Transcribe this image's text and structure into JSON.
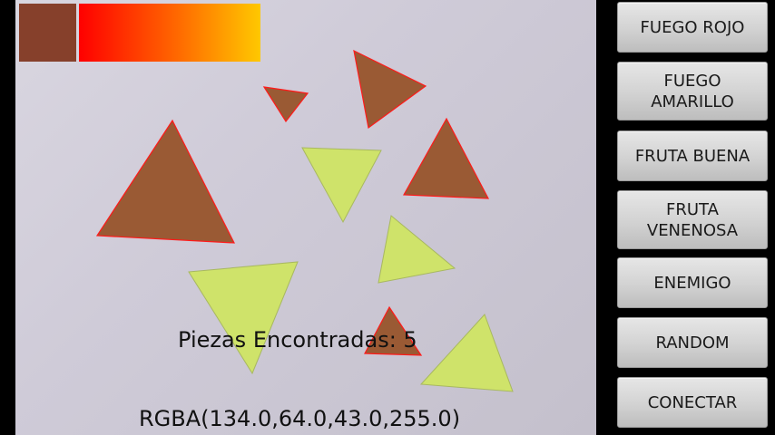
{
  "preview": {
    "detected_color": "#86402b",
    "pieces_text": "Piezas Encontradas: 5",
    "rgba_text": "RGBA(134.0,64.0,43.0,255.0)"
  },
  "buttons": [
    {
      "label": "FUEGO ROJO"
    },
    {
      "label": "FUEGO AMARILLO"
    },
    {
      "label": "FRUTA BUENA"
    },
    {
      "label": "FRUTA VENENOSA"
    },
    {
      "label": "ENEMIGO"
    },
    {
      "label": "RANDOM"
    },
    {
      "label": "CONECTAR"
    }
  ],
  "colors": {
    "brown_piece": "#9a5a34",
    "green_piece": "#cfe36a",
    "outline": "#ff1a1a"
  }
}
